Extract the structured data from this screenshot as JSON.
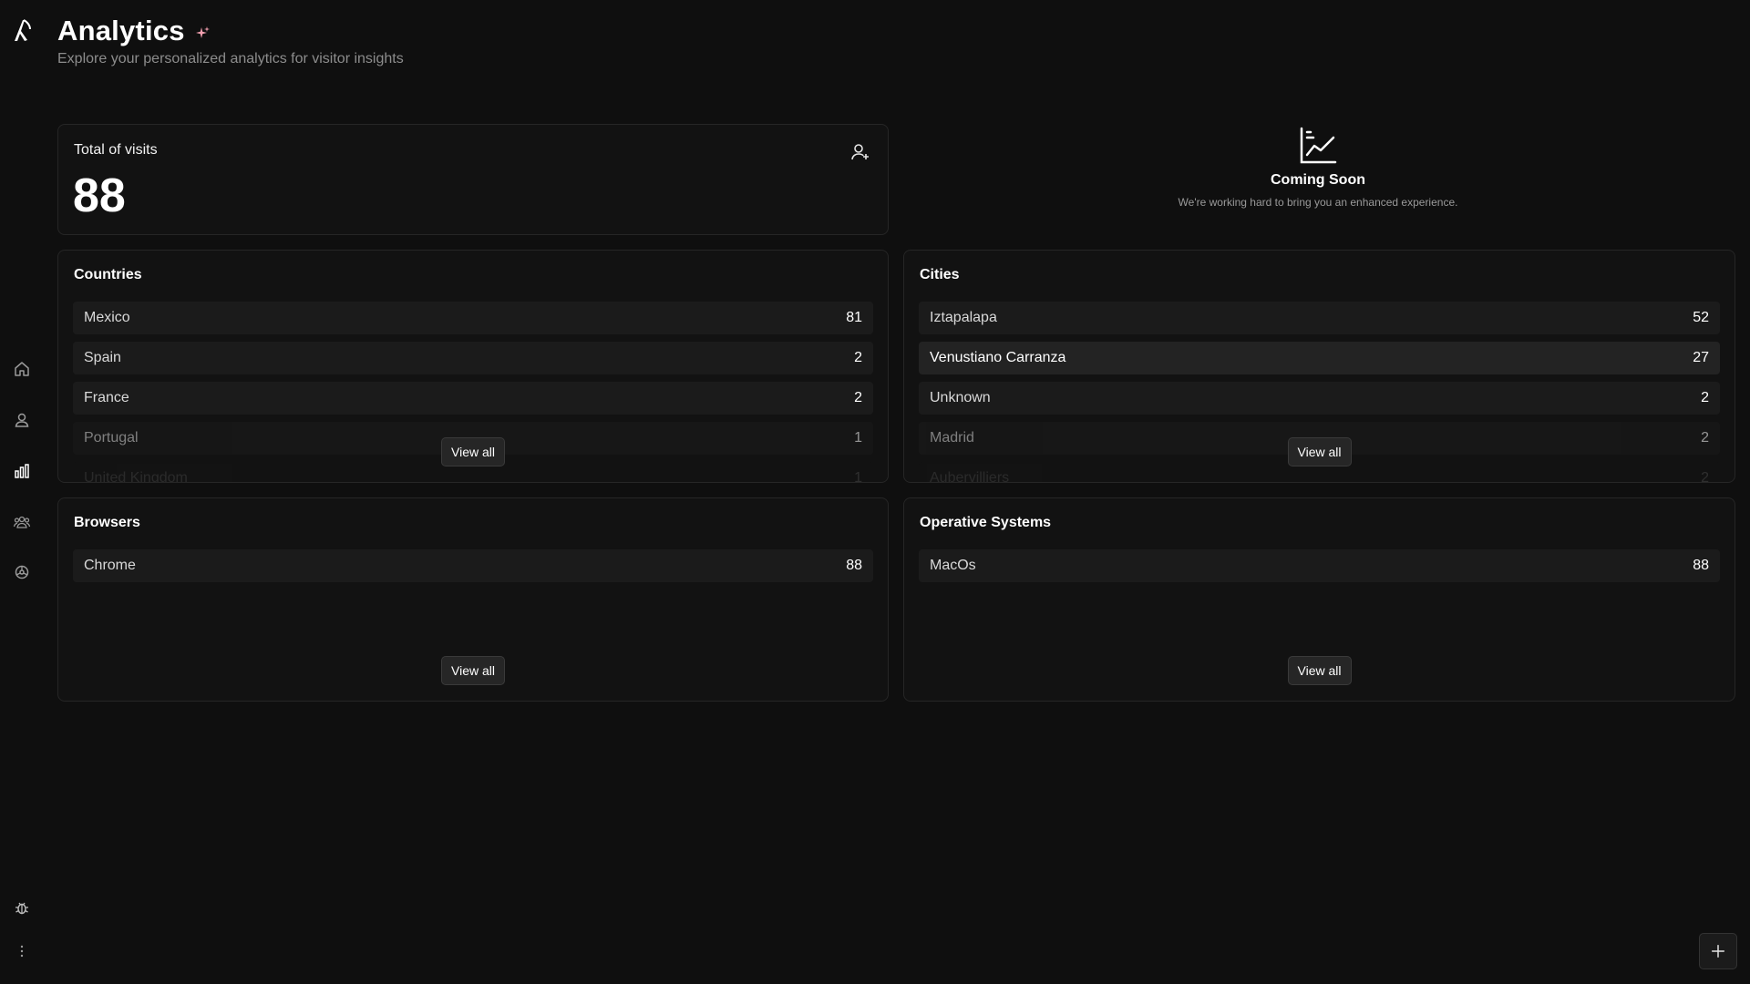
{
  "header": {
    "title": "Analytics",
    "subtitle": "Explore your personalized analytics for visitor insights"
  },
  "sidebar": {
    "items": [
      {
        "icon": "home-icon"
      },
      {
        "icon": "user-icon"
      },
      {
        "icon": "bar-chart-icon"
      },
      {
        "icon": "team-icon"
      },
      {
        "icon": "settings-icon"
      }
    ],
    "bottom": [
      {
        "icon": "bug-icon"
      },
      {
        "icon": "more-vertical-icon"
      }
    ]
  },
  "visits": {
    "label": "Total of visits",
    "value": "88"
  },
  "coming_soon": {
    "title": "Coming Soon",
    "text": "We're working hard to bring you an enhanced experience."
  },
  "countries": {
    "title": "Countries",
    "view_all": "View all",
    "rows": [
      {
        "name": "Mexico",
        "count": "81"
      },
      {
        "name": "Spain",
        "count": "2"
      },
      {
        "name": "France",
        "count": "2"
      },
      {
        "name": "Portugal",
        "count": "1"
      },
      {
        "name": "United Kingdom",
        "count": "1"
      }
    ]
  },
  "cities": {
    "title": "Cities",
    "view_all": "View all",
    "rows": [
      {
        "name": "Iztapalapa",
        "count": "52"
      },
      {
        "name": "Venustiano Carranza",
        "count": "27"
      },
      {
        "name": "Unknown",
        "count": "2"
      },
      {
        "name": "Madrid",
        "count": "2"
      },
      {
        "name": "Aubervilliers",
        "count": "2"
      }
    ]
  },
  "browsers": {
    "title": "Browsers",
    "view_all": "View all",
    "rows": [
      {
        "name": "Chrome",
        "count": "88"
      }
    ]
  },
  "os": {
    "title": "Operative Systems",
    "view_all": "View all",
    "rows": [
      {
        "name": "MacOs",
        "count": "88"
      }
    ]
  },
  "colors": {
    "background": "#0f0f0f",
    "card": "#121212",
    "row": "#1b1b1b",
    "accent_sparkle": "#f2a0b0"
  }
}
